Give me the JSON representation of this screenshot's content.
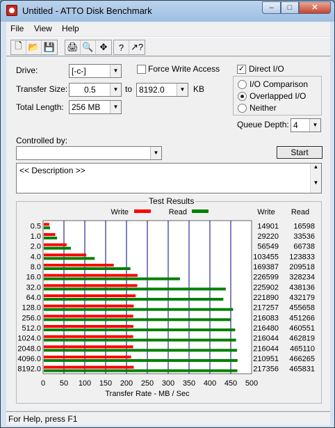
{
  "window": {
    "title": "Untitled - ATTO Disk Benchmark"
  },
  "menu": [
    "File",
    "View",
    "Help"
  ],
  "toolbar_icons": [
    "new-file-icon",
    "open-folder-icon",
    "save-icon",
    "print-icon",
    "print-preview-icon",
    "move-icon",
    "help-icon",
    "context-help-icon"
  ],
  "form": {
    "drive_label": "Drive:",
    "drive_value": "[-c-]",
    "force_write_label": "Force Write Access",
    "direct_io_label": "Direct I/O",
    "direct_io_checked": true,
    "transfer_size_label": "Transfer Size:",
    "transfer_from": "0.5",
    "to_label": "to",
    "transfer_to": "8192.0",
    "kb_label": "KB",
    "total_length_label": "Total Length:",
    "total_length_value": "256 MB",
    "io_options": [
      "I/O Comparison",
      "Overlapped I/O",
      "Neither"
    ],
    "io_selected": 1,
    "queue_depth_label": "Queue Depth:",
    "queue_depth_value": "4",
    "controlled_by_label": "Controlled by:",
    "controlled_by_value": "",
    "start_label": "Start",
    "description": "<< Description >>"
  },
  "status": "For Help, press F1",
  "chart_data": {
    "type": "bar",
    "title": "Test Results",
    "xlabel": "Transfer Rate - MB / Sec",
    "xlim": [
      0,
      500
    ],
    "x_ticks": [
      "0",
      "50",
      "100",
      "150",
      "200",
      "250",
      "300",
      "350",
      "400",
      "450",
      "500"
    ],
    "categories": [
      "0.5",
      "1.0",
      "2.0",
      "4.0",
      "8.0",
      "16.0",
      "32.0",
      "64.0",
      "128.0",
      "256.0",
      "512.0",
      "1024.0",
      "2048.0",
      "4096.0",
      "8192.0"
    ],
    "series": [
      {
        "name": "Write",
        "color": "#ff0000",
        "values": [
          14.9,
          29.2,
          56.5,
          103.5,
          169.4,
          226.6,
          225.9,
          221.9,
          217.3,
          216.1,
          216.5,
          216.0,
          216.0,
          211.0,
          217.4
        ]
      },
      {
        "name": "Read",
        "color": "#008000",
        "values": [
          16.6,
          33.5,
          66.7,
          123.8,
          209.5,
          328.2,
          438.1,
          432.2,
          455.7,
          451.3,
          460.6,
          462.8,
          465.1,
          466.3,
          465.8
        ]
      }
    ],
    "table_headers": [
      "Write",
      "Read"
    ],
    "table": [
      [
        "14901",
        "16598"
      ],
      [
        "29220",
        "33536"
      ],
      [
        "56549",
        "66738"
      ],
      [
        "103455",
        "123833"
      ],
      [
        "169387",
        "209518"
      ],
      [
        "226599",
        "328234"
      ],
      [
        "225902",
        "438136"
      ],
      [
        "221890",
        "432179"
      ],
      [
        "217257",
        "455658"
      ],
      [
        "216083",
        "451266"
      ],
      [
        "216480",
        "460551"
      ],
      [
        "216044",
        "462819"
      ],
      [
        "216044",
        "465110"
      ],
      [
        "210951",
        "466265"
      ],
      [
        "217356",
        "465831"
      ]
    ]
  }
}
